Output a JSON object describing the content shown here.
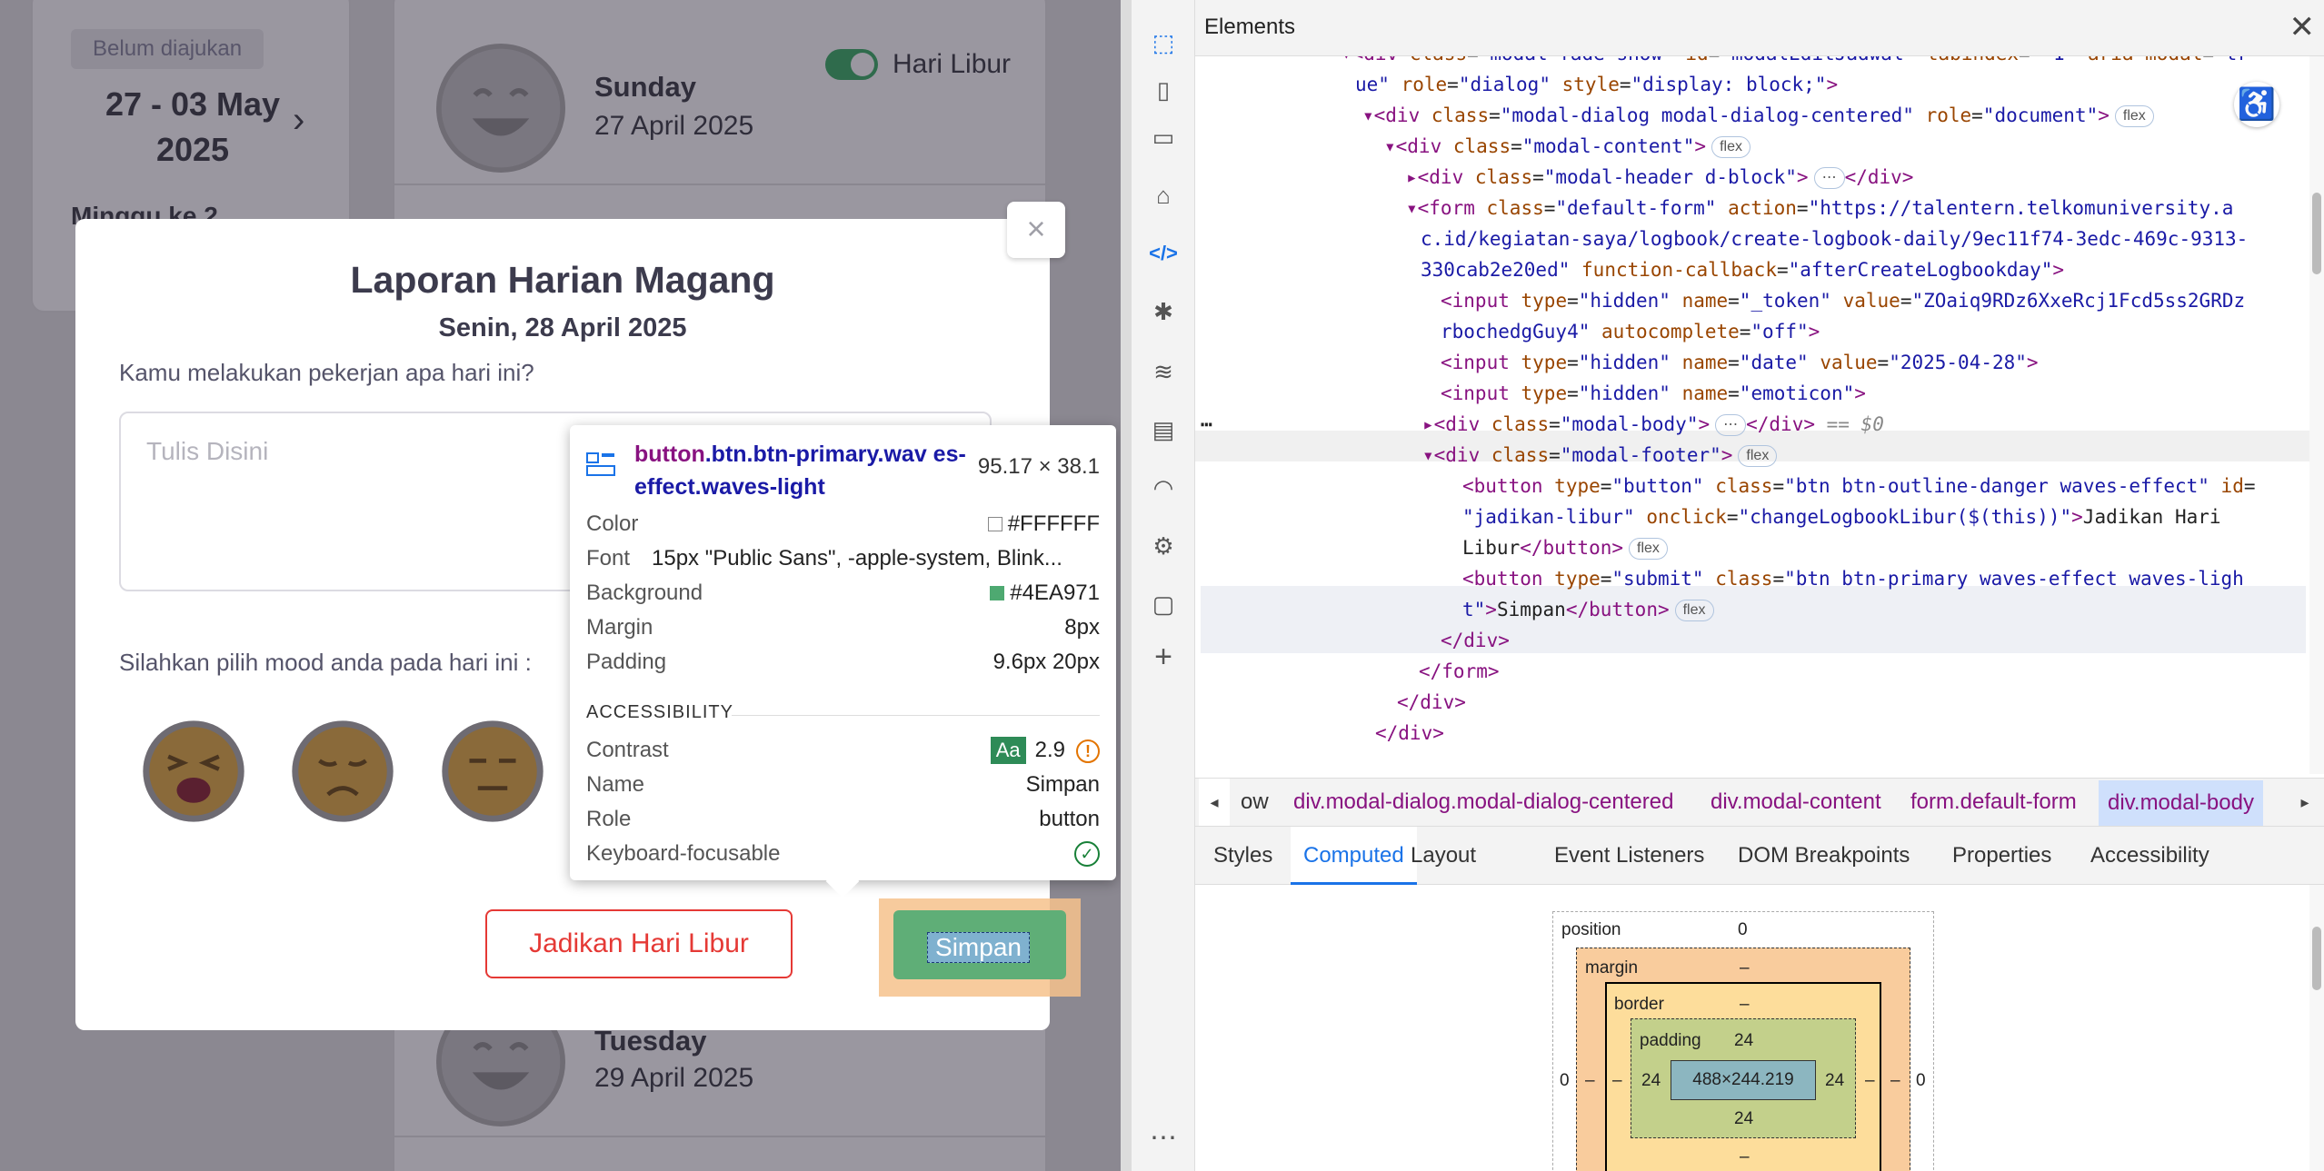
{
  "page": {
    "status_badge": "Belum diajukan",
    "week_line1": "27  -  03 May",
    "week_line2": "2025",
    "week_partial": "Minggu ke 2",
    "holiday_toggle_label": "Hari Libur",
    "day1_name": "Sunday",
    "day1_date": "27 April 2025",
    "day3_name": "Tuesday",
    "day3_date": "29 April 2025"
  },
  "modal": {
    "title": "Laporan Harian Magang",
    "subtitle": "Senin, 28 April 2025",
    "question": "Kamu melakukan pekerjan apa hari ini?",
    "textarea_placeholder": "Tulis Disini",
    "mood_label": "Silahkan pilih mood anda pada hari ini :",
    "holiday_button": "Jadikan Hari Libur",
    "save_button": "Simpan",
    "close_symbol": "×",
    "moods": [
      "tired-face",
      "sad-face",
      "neutral-face"
    ]
  },
  "tooltip": {
    "tag": "button",
    "classes": ".btn.btn-primary.wav es-effect.waves-light",
    "size": "95.17 × 38.1",
    "rows": [
      {
        "k": "Color",
        "v": "#FFFFFF"
      },
      {
        "k": "Font",
        "v": "15px \"Public Sans\", -apple-system, Blink..."
      },
      {
        "k": "Background",
        "v": "#4EA971"
      },
      {
        "k": "Margin",
        "v": "8px"
      },
      {
        "k": "Padding",
        "v": "9.6px 20px"
      }
    ],
    "accessibility_header": "ACCESSIBILITY",
    "contrast_label": "Contrast",
    "contrast_aa": "Aa",
    "contrast_value": "2.9",
    "name_label": "Name",
    "name_value": "Simpan",
    "role_label": "Role",
    "role_value": "button",
    "focus_label": "Keyboard-focusable",
    "color_swatch": "#FFFFFF",
    "bg_swatch": "#4EA971"
  },
  "devtools": {
    "panel_title": "Elements",
    "breadcrumbs": [
      "ow",
      "div.modal-dialog.modal-dialog-centered",
      "div.modal-content",
      "form.default-form",
      "div.modal-body"
    ],
    "tabs": [
      "Styles",
      "Computed",
      "Layout",
      "Event Listeners",
      "DOM Breakpoints",
      "Properties",
      "Accessibility"
    ],
    "active_tab": "Computed",
    "boxmodel": {
      "position_label": "position",
      "position_value": "0",
      "margin_label": "margin",
      "border_label": "border",
      "padding_label": "padding",
      "padding_top": "24",
      "padding_bottom": "24",
      "padding_left": "24",
      "padding_right": "24",
      "content": "488×244.219",
      "dash": "–",
      "zero": "0"
    }
  },
  "colors": {
    "accent": "#1a73e8",
    "primary_button": "#4EA971",
    "danger": "#e53935"
  }
}
